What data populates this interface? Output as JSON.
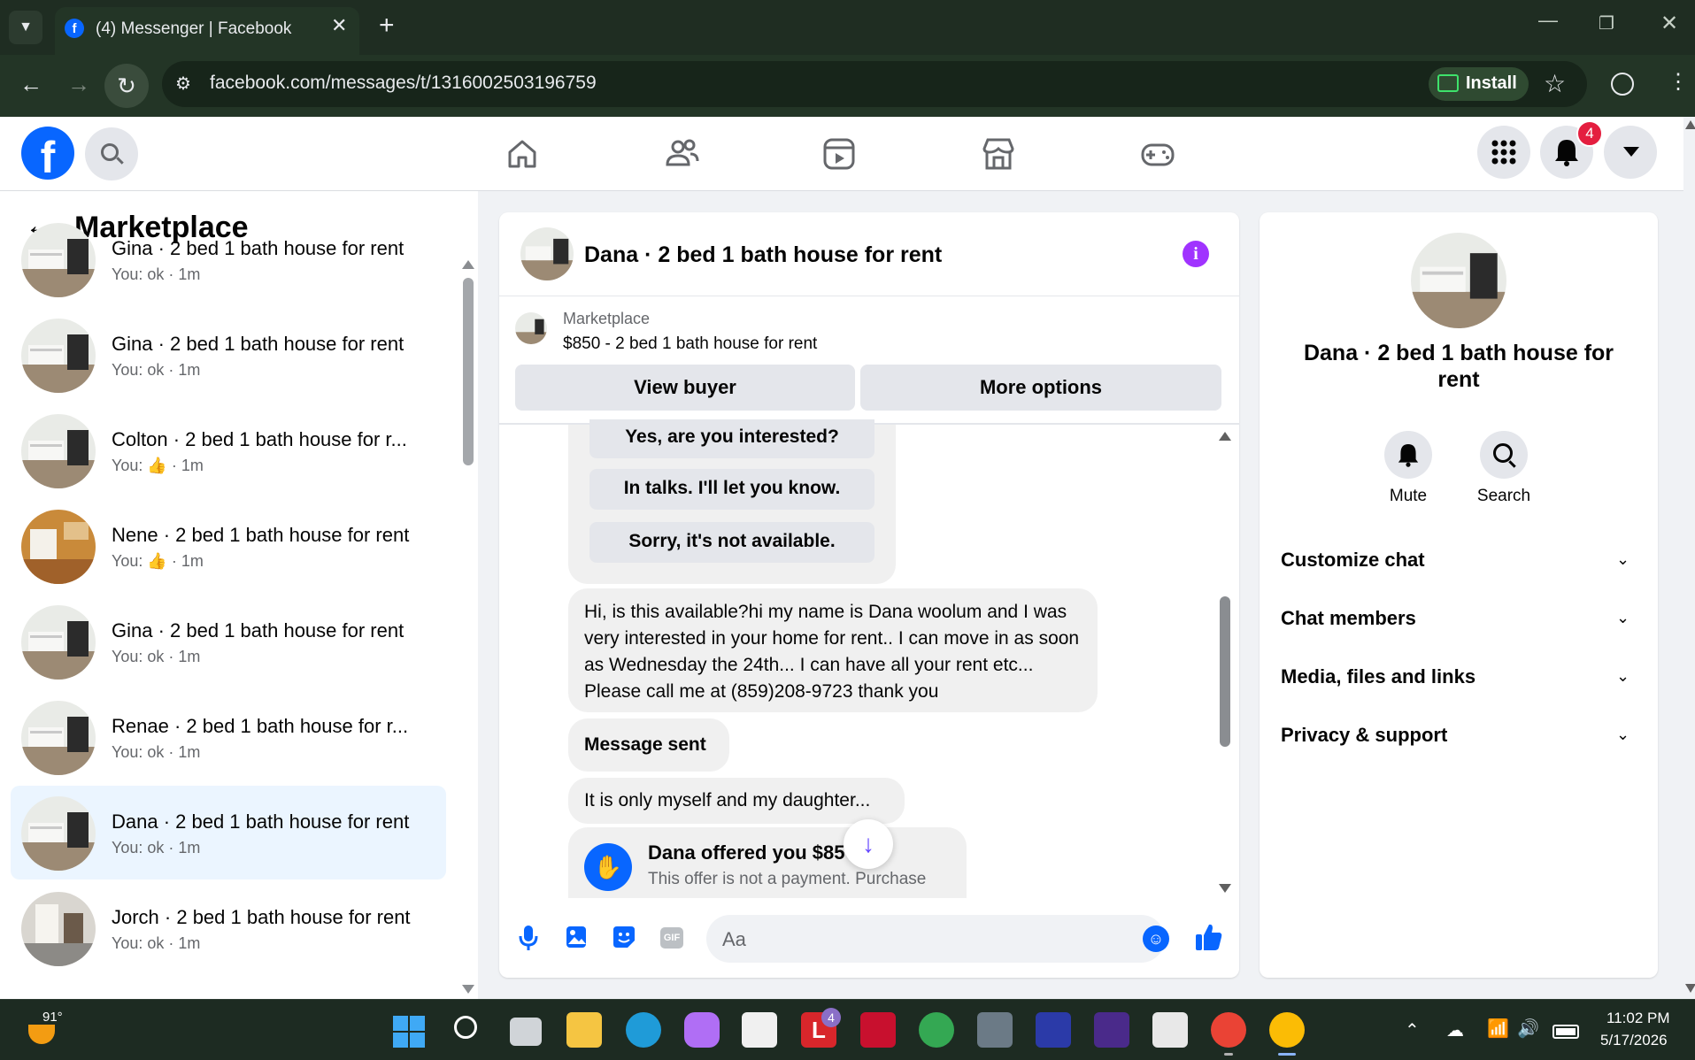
{
  "browser": {
    "tab_title": "(4) Messenger | Facebook",
    "url": "facebook.com/messages/t/1316002503196759",
    "install_label": "Install"
  },
  "header": {
    "notification_count": "4"
  },
  "sidebar": {
    "title": "Marketplace",
    "conversations": [
      {
        "name": "Gina · 2 bed 1 bath house for rent",
        "sub": "You: ok · 1m"
      },
      {
        "name": "Gina · 2 bed 1 bath house for rent",
        "sub": "You: ok · 1m"
      },
      {
        "name": "Colton · 2 bed 1 bath house for r...",
        "sub_prefix": "You:",
        "sub_suffix": "· 1m"
      },
      {
        "name": "Nene · 2 bed 1 bath house for rent",
        "sub_prefix": "You:",
        "sub_suffix": "· 1m"
      },
      {
        "name": "Gina · 2 bed 1 bath house for rent",
        "sub": "You: ok · 1m"
      },
      {
        "name": "Renae · 2 bed 1 bath house for r...",
        "sub": "You: ok · 1m"
      },
      {
        "name": "Dana · 2 bed 1 bath house for rent",
        "sub": "You: ok · 1m"
      },
      {
        "name": "Jorch · 2 bed 1 bath house for rent",
        "sub": "You: ok · 1m"
      }
    ]
  },
  "chat": {
    "title": "Dana · 2 bed 1 bath house for rent",
    "listing_source": "Marketplace",
    "listing_title": "$850 - 2 bed 1 bath house for rent",
    "view_buyer_label": "View buyer",
    "more_options_label": "More options",
    "quick_replies": [
      "Yes, are you interested?",
      "In talks. I'll let you know.",
      "Sorry, it's not available."
    ],
    "messages": [
      "Hi, is this available?hi  my name is Dana woolum and I was very interested in your home for rent.. I can move in as soon as Wednesday the 24th... I can have all your rent etc... Please call me at (859)208-9723 thank you",
      "Message sent",
      "It is only myself and my daughter..."
    ],
    "offer_title": "Dana offered you $85",
    "offer_sub": "This offer is not a payment. Purchase",
    "composer_placeholder": "Aa",
    "composer_gif": "GIF"
  },
  "details": {
    "name": "Dana · 2 bed 1 bath house for rent",
    "mute_label": "Mute",
    "search_label": "Search",
    "sections": [
      "Customize chat",
      "Chat members",
      "Media, files and links",
      "Privacy & support"
    ]
  },
  "taskbar": {
    "weather": "91°",
    "time": "11:02 PM",
    "date": "5/17/2026",
    "mail_badge": "4"
  },
  "colors": {
    "fb_blue": "#0866ff",
    "messenger_purple": "#a033ff",
    "badge_red": "#e41e3f",
    "active_conv": "#ebf5ff"
  }
}
